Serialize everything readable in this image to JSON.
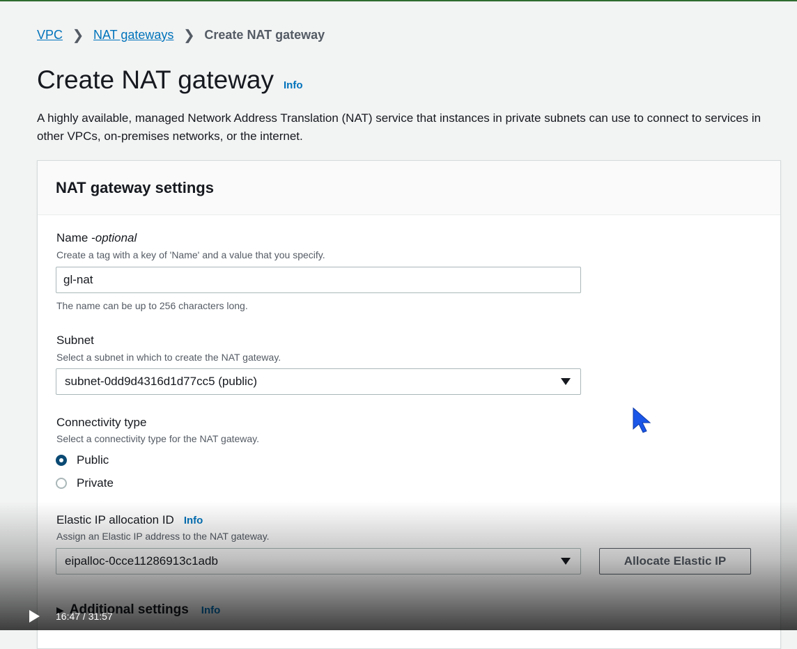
{
  "breadcrumb": {
    "items": [
      "VPC",
      "NAT gateways"
    ],
    "current": "Create NAT gateway"
  },
  "page": {
    "title": "Create NAT gateway",
    "info": "Info",
    "description": "A highly available, managed Network Address Translation (NAT) service that instances in private subnets can use to connect to services in other VPCs, on-premises networks, or the internet."
  },
  "settings": {
    "title": "NAT gateway settings",
    "name": {
      "label": "Name - ",
      "optional": "optional",
      "hint": "Create a tag with a key of 'Name' and a value that you specify.",
      "value": "gl-nat",
      "constraint": "The name can be up to 256 characters long."
    },
    "subnet": {
      "label": "Subnet",
      "hint": "Select a subnet in which to create the NAT gateway.",
      "value": "subnet-0dd9d4316d1d77cc5 (public)"
    },
    "connectivity": {
      "label": "Connectivity type",
      "hint": "Select a connectivity type for the NAT gateway.",
      "options": [
        "Public",
        "Private"
      ],
      "selected": "Public"
    },
    "elastic_ip": {
      "label": "Elastic IP allocation ID",
      "info": "Info",
      "hint": "Assign an Elastic IP address to the NAT gateway.",
      "value": "eipalloc-0cce11286913c1adb",
      "button": "Allocate Elastic IP"
    },
    "additional": {
      "label": "Additional settings",
      "info": "Info"
    }
  },
  "video": {
    "time": "16:47 / 31:57"
  },
  "colors": {
    "link": "#0073bb",
    "radio_selected": "#0a4a74",
    "cursor": "#1a56e8"
  }
}
